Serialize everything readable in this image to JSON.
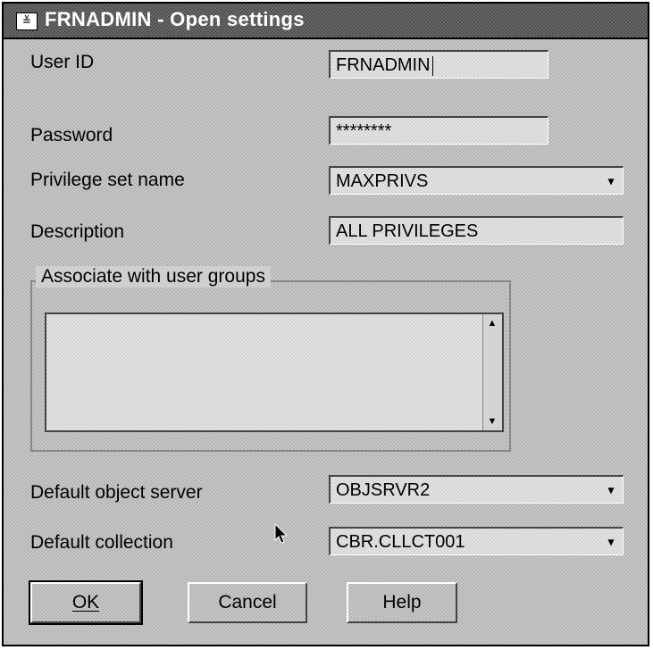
{
  "window": {
    "title": "FRNADMIN - Open settings",
    "system_menu_glyph": "≚"
  },
  "form": {
    "user_id": {
      "label": "User ID",
      "value": "FRNADMIN"
    },
    "password": {
      "label": "Password",
      "value": "********"
    },
    "privilege_set": {
      "label": "Privilege set name",
      "value": "MAXPRIVS"
    },
    "description": {
      "label": "Description",
      "value": "ALL PRIVILEGES"
    },
    "user_groups": {
      "label": "Associate with user groups",
      "items": []
    },
    "default_object_server": {
      "label": "Default object server",
      "value": "OBJSRVR2"
    },
    "default_collection": {
      "label": "Default collection",
      "value": "CBR.CLLCT001"
    }
  },
  "buttons": {
    "ok": "OK",
    "cancel": "Cancel",
    "help": "Help"
  },
  "icons": {
    "dropdown": "dropdown-arrow-icon",
    "scroll_up": "scroll-up-icon",
    "scroll_down": "scroll-down-icon",
    "pointer": "mouse-pointer-icon"
  }
}
